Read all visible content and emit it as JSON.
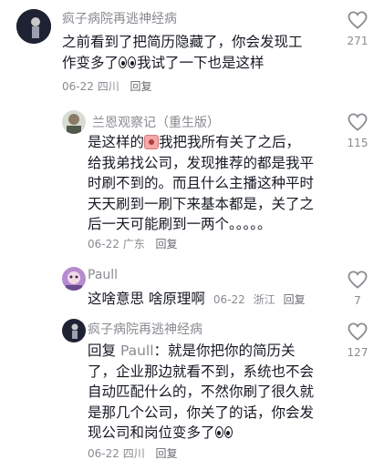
{
  "comments": [
    {
      "author": "疯子病院再逃神经病",
      "body_lines": [
        "之前看到了把简历隐藏了，你会发现工",
        "作变多了",
        "我试了一下也是这样"
      ],
      "date": "06-22",
      "location": "四川",
      "reply_label": "回复",
      "likes": "271"
    },
    {
      "author": "兰恩观察记（重生版）",
      "body_lines": [
        "是这样的",
        "我把我所有关了之后，",
        "给我弟找公司，发现推荐的都是我平",
        "时刷不到的。而且什么主播这种平时",
        "天天刷到一刷下来基本都是，关了之",
        "后一天可能刷到一两个。。。。。"
      ],
      "date": "06-22",
      "location": "广东",
      "reply_label": "回复",
      "likes": "115"
    },
    {
      "author": "Paull",
      "body": "这啥意思 啥原理啊",
      "date": "06-22",
      "location": "浙江",
      "reply_label": "回复",
      "likes": "7"
    },
    {
      "author": "疯子病院再逃神经病",
      "reply_prefix": "回复",
      "reply_to": "Paull",
      "body_lines": [
        "：就是你把你的简历关",
        "了，企业那边就看不到，系统也不会",
        "自动匹配什么的，不然你刷了很久就",
        "是那几个公司，你关了的话，你会发",
        "现公司和岗位变多了"
      ],
      "date": "06-22",
      "location": "四川",
      "reply_label": "回复",
      "likes": "127"
    }
  ],
  "icons": {
    "like": "heart-outline-icon",
    "emoji_eyes": "eyes-emoji-icon",
    "emoji_face": "sad-face-emoji-icon"
  }
}
